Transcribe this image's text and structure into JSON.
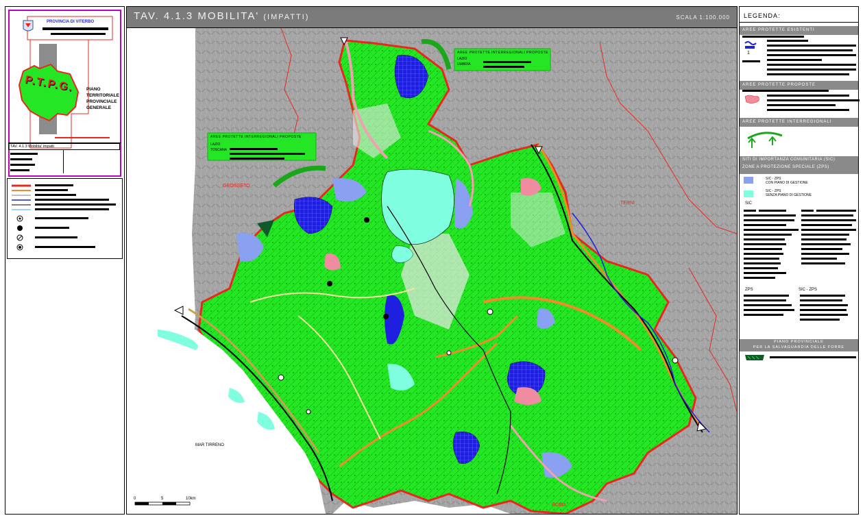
{
  "cartouche": {
    "province": "PROVINCIA DI VITERBO",
    "logo_letters": "P.T.P.G.",
    "plan_title": [
      "PIANO",
      "TERRITORIALE",
      "PROVINCIALE",
      "GENERALE"
    ],
    "table_ref": "TAV. 4.1.3 Mobilita' impatti"
  },
  "header": {
    "title_main": "TAV. 4.1.3 MOBILITA'",
    "title_sub": "(IMPATTI)",
    "scale": "SCALA 1:100.000"
  },
  "map": {
    "places": {
      "grosseto": "GROSSETO",
      "roma": "ROMA",
      "terni": "TERNI",
      "mar_tirreno": "MAR TIRRENO"
    },
    "scalebar": {
      "labels": [
        "0",
        "5",
        "10km"
      ]
    },
    "note_boxes": [
      {
        "title": "AREE PROTETTE INTERREGIONALI PROPOSTE",
        "lines": [
          "LAZIO",
          "UMBRIA"
        ]
      },
      {
        "title": "AREE PROTETTE INTERREGIONALI PROPOSTE",
        "lines": [
          "LAZIO",
          "TOSCANA"
        ]
      }
    ],
    "colors": {
      "background_relief": "#9a9a9a",
      "province_green": "#25e625",
      "boundary": "#e8281e",
      "lake": "#7fffdf",
      "protected_blue": "#1f1fe0",
      "sic_blue": "#8aa0f0",
      "road_orange": "#f08c28",
      "road_pink": "#f0a0b0"
    }
  },
  "legend": {
    "title": "LEGENDA:",
    "sections": {
      "existing": "AREE PROTETTE ESISTENTI",
      "proposed": "AREE PROTETTE PROPOSTE",
      "interregional": "AREE PROTETTE INTERREGIONALI PROPOSTE",
      "sic": "SITI DI IMPORTANZA COMUNITARIA (SIC)",
      "zps": "ZONE A PROTEZIONE SPECIALE (ZPS)"
    },
    "sic_zps_with_plan": [
      "SIC - ZPS",
      "CON PIANO DI GESTIONE"
    ],
    "sic_zps_without_plan": [
      "SIC - ZPS",
      "SENZA PIANO DI GESTIONE"
    ],
    "sic_label": "SIC",
    "zps_label": "ZPS",
    "sic_zps_label": "SIC - ZPS",
    "forest_plan": [
      "PIANO PROVINCIALE",
      "PER LA SALVAGUARDIA DELLE FORRE"
    ]
  }
}
